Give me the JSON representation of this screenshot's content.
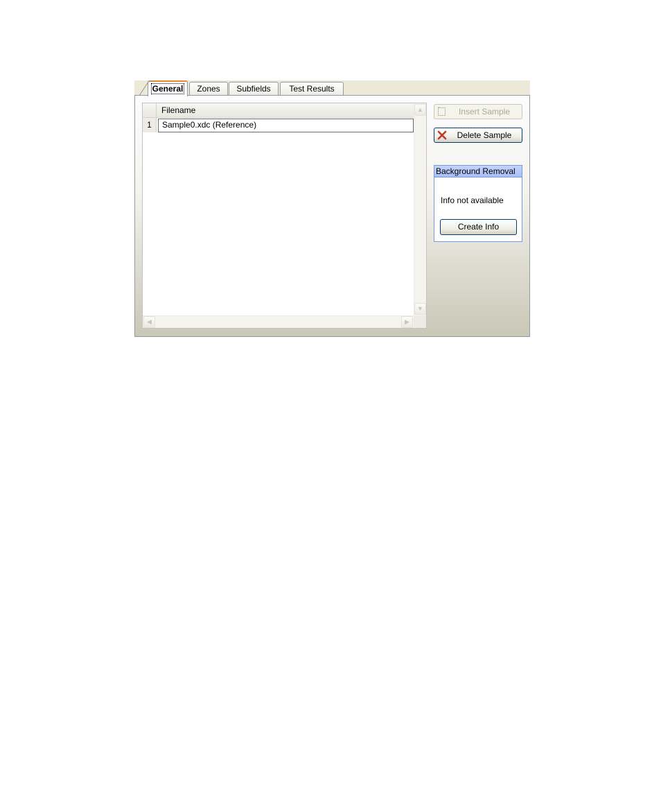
{
  "tabs": [
    {
      "label": "General",
      "active": true
    },
    {
      "label": "Zones",
      "active": false
    },
    {
      "label": "Subfields",
      "active": false
    },
    {
      "label": "Test Results",
      "active": false
    }
  ],
  "grid": {
    "column_header": "Filename",
    "rows": [
      {
        "number": "1",
        "filename": "Sample0.xdc (Reference)"
      }
    ]
  },
  "actions": {
    "insert_label": "Insert Sample",
    "insert_enabled": false,
    "delete_label": "Delete Sample",
    "delete_icon": "red-x-icon"
  },
  "background_removal": {
    "title": "Background Removal",
    "info_text": "Info not available",
    "create_label": "Create Info"
  },
  "colors": {
    "active_tab_accent": "#e68b2c",
    "group_header": "#a9c0f5",
    "delete_icon": "#c0392b"
  }
}
